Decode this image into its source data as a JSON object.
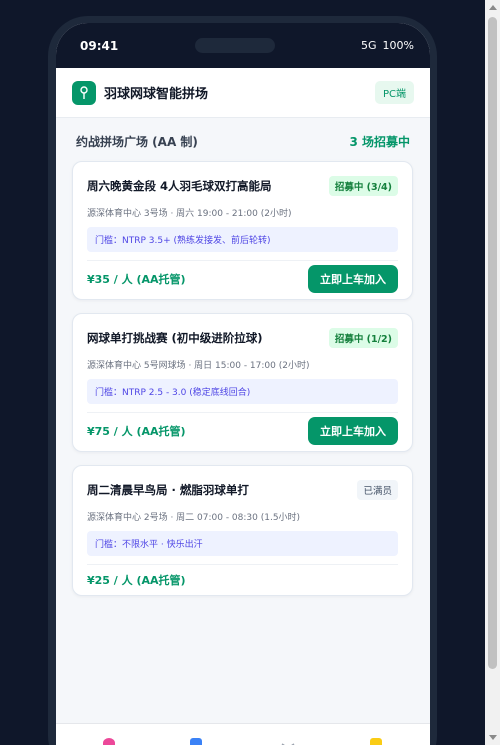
{
  "status_bar": {
    "time": "09:41",
    "network": "5G",
    "battery": "100%"
  },
  "app": {
    "title": "羽球网球智能拼场",
    "pc_label": "PC端"
  },
  "section": {
    "title": "约战拼场广场 (AA 制)",
    "count": "3 场招募中"
  },
  "cards": [
    {
      "title": "周六晚黄金段 4人羽毛球双打高能局",
      "status": "招募中 (3/4)",
      "venue": "源深体育中心 3号场 · 周六 19:00 - 21:00 (2小时)",
      "threshold": "门槛：NTRP 3.5+ (熟练发接发、前后轮转)",
      "price": "¥35 / 人 (AA托管)",
      "action": "立即上车加入"
    },
    {
      "title": "网球单打挑战赛 (初中级进阶拉球)",
      "status": "招募中 (1/2)",
      "venue": "源深体育中心 5号网球场 · 周日 15:00 - 17:00 (2小时)",
      "threshold": "门槛：NTRP 2.5 - 3.0 (稳定底线回合)",
      "price": "¥75 / 人 (AA托管)",
      "action": "立即上车加入"
    },
    {
      "title": "周二清晨早鸟局 · 燃脂羽球单打",
      "status": "已满员",
      "venue": "源深体育中心 2号场 · 周二 07:00 - 08:30 (1.5小时)",
      "threshold": "门槛：不限水平 · 快乐出汗",
      "price": "¥25 / 人 (AA托管)"
    }
  ],
  "tabbar": {
    "icons": [
      "pin-icon",
      "calendar-icon",
      "racket-icon",
      "wallet-icon"
    ]
  },
  "colors": {
    "accent": "#059669",
    "background": "#0f172a",
    "threshold_bg": "#eef2ff"
  }
}
